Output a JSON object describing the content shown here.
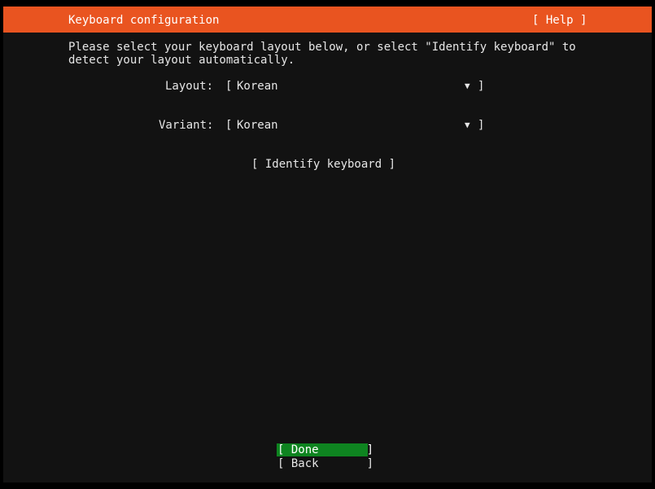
{
  "header": {
    "title": "Keyboard configuration",
    "help_button": "[ Help ]"
  },
  "intro": {
    "line1": "Please select your keyboard layout below, or select \"Identify keyboard\" to",
    "line2": "detect your layout automatically."
  },
  "layout_field": {
    "label": "Layout:",
    "open_bracket": "[",
    "value": "Korean",
    "arrow": "▼",
    "close_bracket": "]"
  },
  "variant_field": {
    "label": "Variant:",
    "open_bracket": "[",
    "value": "Korean",
    "arrow": "▼",
    "close_bracket": "]"
  },
  "identify_button": "[ Identify keyboard ]",
  "footer": {
    "done_button": "[ Done       ]",
    "back_button": "[ Back       ]"
  },
  "colors": {
    "header_bg": "#e95420",
    "screen_bg": "#121212",
    "focus_bg": "#0e8420",
    "text": "#e6e6e6"
  }
}
